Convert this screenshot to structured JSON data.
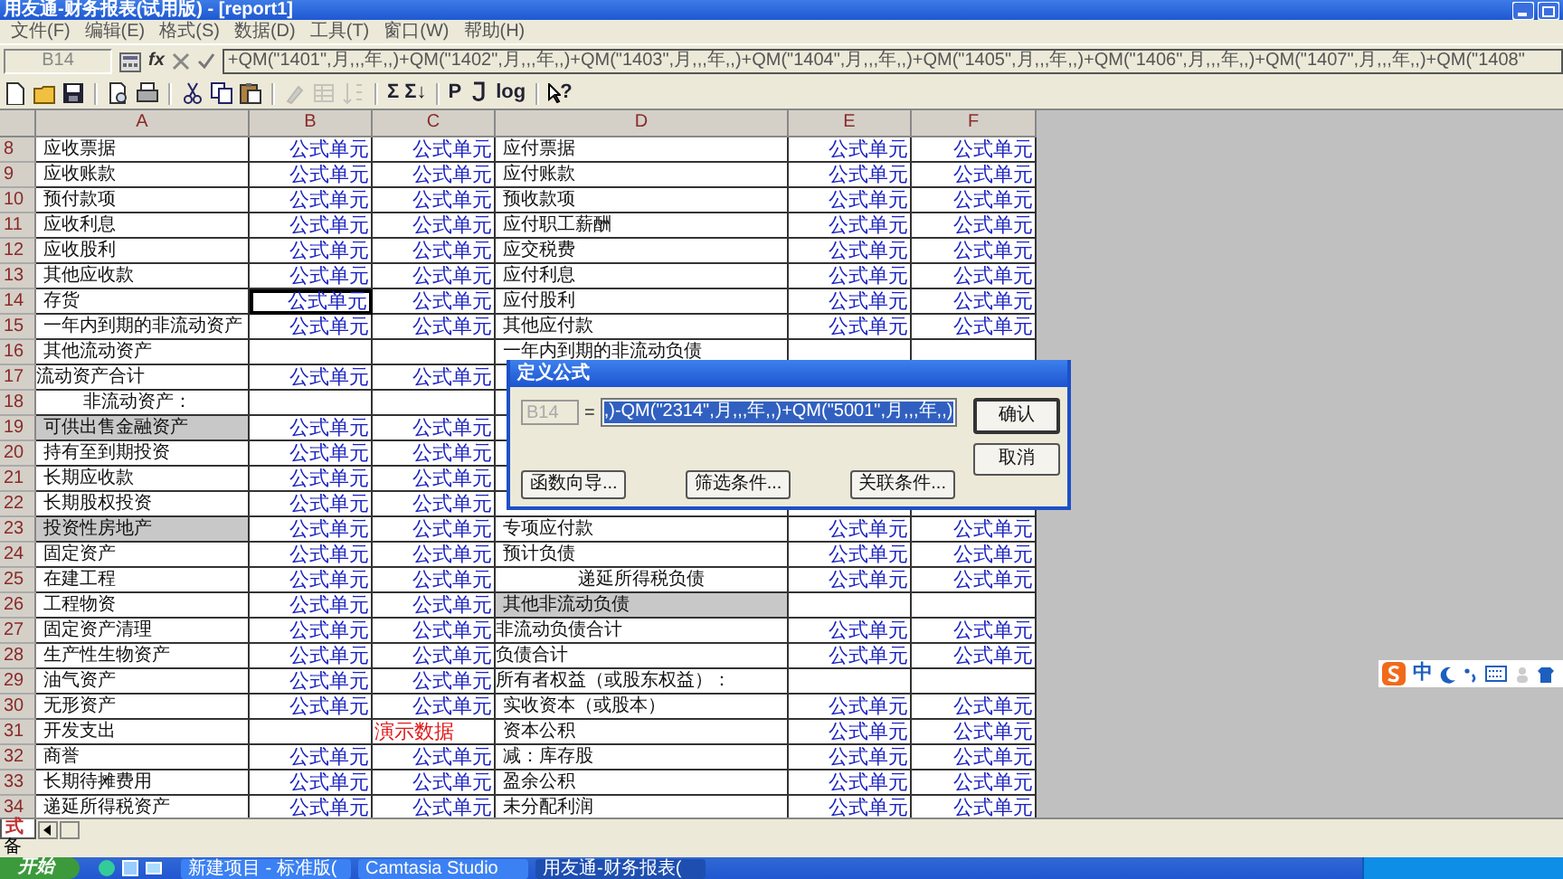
{
  "window": {
    "title": "用友通-财务报表(试用版) - [report1]"
  },
  "menu": [
    "文件(F)",
    "编辑(E)",
    "格式(S)",
    "数据(D)",
    "工具(T)",
    "窗口(W)",
    "帮助(H)"
  ],
  "formula_bar": {
    "cell": "B14",
    "fx": "fx",
    "formula": "+QM(\"1401\",月,,,年,,)+QM(\"1402\",月,,,年,,)+QM(\"1403\",月,,,年,,)+QM(\"1404\",月,,,年,,)+QM(\"1405\",月,,,年,,)+QM(\"1406\",月,,,年,,)+QM(\"1407\",月,,,年,,)+QM(\"1408\""
  },
  "toolbar": [
    {
      "kind": "new",
      "disabled": false
    },
    {
      "kind": "open",
      "disabled": false
    },
    {
      "kind": "save",
      "disabled": false
    },
    {
      "kind": "sep",
      "disabled": false
    },
    {
      "kind": "preview",
      "disabled": false
    },
    {
      "kind": "print",
      "disabled": false
    },
    {
      "kind": "sep",
      "disabled": false
    },
    {
      "kind": "cut",
      "disabled": false
    },
    {
      "kind": "copy",
      "disabled": false
    },
    {
      "kind": "paste",
      "disabled": false
    },
    {
      "kind": "sep",
      "disabled": false
    },
    {
      "kind": "brush",
      "disabled": true
    },
    {
      "kind": "table",
      "disabled": true
    },
    {
      "kind": "sort",
      "disabled": true
    },
    {
      "kind": "sep",
      "disabled": false
    },
    {
      "kind": "text",
      "label": "Σ",
      "disabled": false
    },
    {
      "kind": "text",
      "label": "Σ↓",
      "disabled": false
    },
    {
      "kind": "sep",
      "disabled": false
    },
    {
      "kind": "text",
      "label": "P",
      "disabled": false
    },
    {
      "kind": "hook",
      "disabled": false
    },
    {
      "kind": "text",
      "label": "log",
      "disabled": false
    },
    {
      "kind": "sep",
      "disabled": false
    },
    {
      "kind": "help",
      "label": "?",
      "disabled": false
    }
  ],
  "sheet": {
    "columns": [
      "A",
      "B",
      "C",
      "D",
      "E",
      "F"
    ],
    "rows": [
      {
        "number": "8",
        "cells": [
          {
            "text": "应收票据",
            "kind": "label",
            "shaded": false,
            "selected": false
          },
          {
            "text": "公式单元",
            "kind": "formula",
            "shaded": false,
            "selected": false
          },
          {
            "text": "公式单元",
            "kind": "formula",
            "shaded": false,
            "selected": false
          },
          {
            "text": "应付票据",
            "kind": "label",
            "shaded": false,
            "selected": false
          },
          {
            "text": "公式单元",
            "kind": "formula",
            "shaded": false,
            "selected": false
          },
          {
            "text": "公式单元",
            "kind": "formula",
            "shaded": false,
            "selected": false
          }
        ]
      },
      {
        "number": "9",
        "cells": [
          {
            "text": "应收账款",
            "kind": "label",
            "shaded": false,
            "selected": false
          },
          {
            "text": "公式单元",
            "kind": "formula",
            "shaded": false,
            "selected": false
          },
          {
            "text": "公式单元",
            "kind": "formula",
            "shaded": false,
            "selected": false
          },
          {
            "text": "应付账款",
            "kind": "label",
            "shaded": false,
            "selected": false
          },
          {
            "text": "公式单元",
            "kind": "formula",
            "shaded": false,
            "selected": false
          },
          {
            "text": "公式单元",
            "kind": "formula",
            "shaded": false,
            "selected": false
          }
        ]
      },
      {
        "number": "10",
        "cells": [
          {
            "text": "预付款项",
            "kind": "label",
            "shaded": false,
            "selected": false
          },
          {
            "text": "公式单元",
            "kind": "formula",
            "shaded": false,
            "selected": false
          },
          {
            "text": "公式单元",
            "kind": "formula",
            "shaded": false,
            "selected": false
          },
          {
            "text": "预收款项",
            "kind": "label",
            "shaded": false,
            "selected": false
          },
          {
            "text": "公式单元",
            "kind": "formula",
            "shaded": false,
            "selected": false
          },
          {
            "text": "公式单元",
            "kind": "formula",
            "shaded": false,
            "selected": false
          }
        ]
      },
      {
        "number": "11",
        "cells": [
          {
            "text": "应收利息",
            "kind": "label",
            "shaded": false,
            "selected": false
          },
          {
            "text": "公式单元",
            "kind": "formula",
            "shaded": false,
            "selected": false
          },
          {
            "text": "公式单元",
            "kind": "formula",
            "shaded": false,
            "selected": false
          },
          {
            "text": "应付职工薪酬",
            "kind": "label",
            "shaded": false,
            "selected": false
          },
          {
            "text": "公式单元",
            "kind": "formula",
            "shaded": false,
            "selected": false
          },
          {
            "text": "公式单元",
            "kind": "formula",
            "shaded": false,
            "selected": false
          }
        ]
      },
      {
        "number": "12",
        "cells": [
          {
            "text": "应收股利",
            "kind": "label",
            "shaded": false,
            "selected": false
          },
          {
            "text": "公式单元",
            "kind": "formula",
            "shaded": false,
            "selected": false
          },
          {
            "text": "公式单元",
            "kind": "formula",
            "shaded": false,
            "selected": false
          },
          {
            "text": "应交税费",
            "kind": "label",
            "shaded": false,
            "selected": false
          },
          {
            "text": "公式单元",
            "kind": "formula",
            "shaded": false,
            "selected": false
          },
          {
            "text": "公式单元",
            "kind": "formula",
            "shaded": false,
            "selected": false
          }
        ]
      },
      {
        "number": "13",
        "cells": [
          {
            "text": "其他应收款",
            "kind": "label",
            "shaded": false,
            "selected": false
          },
          {
            "text": "公式单元",
            "kind": "formula",
            "shaded": false,
            "selected": false
          },
          {
            "text": "公式单元",
            "kind": "formula",
            "shaded": false,
            "selected": false
          },
          {
            "text": "应付利息",
            "kind": "label",
            "shaded": false,
            "selected": false
          },
          {
            "text": "公式单元",
            "kind": "formula",
            "shaded": false,
            "selected": false
          },
          {
            "text": "公式单元",
            "kind": "formula",
            "shaded": false,
            "selected": false
          }
        ]
      },
      {
        "number": "14",
        "cells": [
          {
            "text": "存货",
            "kind": "label",
            "shaded": false,
            "selected": false
          },
          {
            "text": "公式单元",
            "kind": "formula",
            "shaded": false,
            "selected": true
          },
          {
            "text": "公式单元",
            "kind": "formula",
            "shaded": false,
            "selected": false
          },
          {
            "text": "应付股利",
            "kind": "label",
            "shaded": false,
            "selected": false
          },
          {
            "text": "公式单元",
            "kind": "formula",
            "shaded": false,
            "selected": false
          },
          {
            "text": "公式单元",
            "kind": "formula",
            "shaded": false,
            "selected": false
          }
        ]
      },
      {
        "number": "15",
        "cells": [
          {
            "text": "一年内到期的非流动资产",
            "kind": "label",
            "shaded": false,
            "selected": false
          },
          {
            "text": "公式单元",
            "kind": "formula",
            "shaded": false,
            "selected": false
          },
          {
            "text": "公式单元",
            "kind": "formula",
            "shaded": false,
            "selected": false
          },
          {
            "text": "其他应付款",
            "kind": "label",
            "shaded": false,
            "selected": false
          },
          {
            "text": "公式单元",
            "kind": "formula",
            "shaded": false,
            "selected": false
          },
          {
            "text": "公式单元",
            "kind": "formula",
            "shaded": false,
            "selected": false
          }
        ]
      },
      {
        "number": "16",
        "cells": [
          {
            "text": "其他流动资产",
            "kind": "label",
            "shaded": false,
            "selected": false
          },
          {
            "kind": "blank",
            "shaded": false,
            "selected": false
          },
          {
            "kind": "blank",
            "shaded": false,
            "selected": false
          },
          {
            "text": "一年内到期的非流动负债",
            "kind": "label",
            "shaded": false,
            "selected": false
          },
          {
            "kind": "blank",
            "shaded": false,
            "selected": false
          },
          {
            "kind": "blank",
            "shaded": false,
            "selected": false
          }
        ]
      },
      {
        "number": "17",
        "cells": [
          {
            "text": "流动资产合计",
            "kind": "heading",
            "shaded": false,
            "selected": false
          },
          {
            "text": "公式单元",
            "kind": "formula",
            "shaded": false,
            "selected": false
          },
          {
            "text": "公式单元",
            "kind": "formula",
            "shaded": false,
            "selected": false
          }
        ]
      },
      {
        "number": "18",
        "cells": [
          {
            "text": "非流动资产：",
            "kind": "subhead",
            "shaded": false,
            "selected": false
          },
          {
            "kind": "blank",
            "shaded": false,
            "selected": false
          },
          {
            "kind": "blank",
            "shaded": false,
            "selected": false
          }
        ]
      },
      {
        "number": "19",
        "cells": [
          {
            "text": "可供出售金融资产",
            "kind": "label",
            "shaded": true,
            "selected": false
          },
          {
            "text": "公式单元",
            "kind": "formula",
            "shaded": false,
            "selected": false
          },
          {
            "text": "公式单元",
            "kind": "formula",
            "shaded": false,
            "selected": false
          }
        ]
      },
      {
        "number": "20",
        "cells": [
          {
            "text": "持有至到期投资",
            "kind": "label",
            "shaded": false,
            "selected": false
          },
          {
            "text": "公式单元",
            "kind": "formula",
            "shaded": false,
            "selected": false
          },
          {
            "text": "公式单元",
            "kind": "formula",
            "shaded": false,
            "selected": false
          }
        ]
      },
      {
        "number": "21",
        "cells": [
          {
            "text": "长期应收款",
            "kind": "label",
            "shaded": false,
            "selected": false
          },
          {
            "text": "公式单元",
            "kind": "formula",
            "shaded": false,
            "selected": false
          },
          {
            "text": "公式单元",
            "kind": "formula",
            "shaded": false,
            "selected": false
          }
        ]
      },
      {
        "number": "22",
        "cells": [
          {
            "text": "长期股权投资",
            "kind": "label",
            "shaded": false,
            "selected": false
          },
          {
            "text": "公式单元",
            "kind": "formula",
            "shaded": false,
            "selected": false
          },
          {
            "text": "公式单元",
            "kind": "formula",
            "shaded": false,
            "selected": false
          }
        ]
      },
      {
        "number": "23",
        "cells": [
          {
            "text": "投资性房地产",
            "kind": "label",
            "shaded": true,
            "selected": false
          },
          {
            "text": "公式单元",
            "kind": "formula",
            "shaded": false,
            "selected": false
          },
          {
            "text": "公式单元",
            "kind": "formula",
            "shaded": false,
            "selected": false
          },
          {
            "text": "专项应付款",
            "kind": "label",
            "shaded": false,
            "selected": false
          },
          {
            "text": "公式单元",
            "kind": "formula",
            "shaded": false,
            "selected": false
          },
          {
            "text": "公式单元",
            "kind": "formula",
            "shaded": false,
            "selected": false
          }
        ]
      },
      {
        "number": "24",
        "cells": [
          {
            "text": "固定资产",
            "kind": "label",
            "shaded": false,
            "selected": false
          },
          {
            "text": "公式单元",
            "kind": "formula",
            "shaded": false,
            "selected": false
          },
          {
            "text": "公式单元",
            "kind": "formula",
            "shaded": false,
            "selected": false
          },
          {
            "text": "预计负债",
            "kind": "label",
            "shaded": false,
            "selected": false
          },
          {
            "text": "公式单元",
            "kind": "formula",
            "shaded": false,
            "selected": false
          },
          {
            "text": "公式单元",
            "kind": "formula",
            "shaded": false,
            "selected": false
          }
        ]
      },
      {
        "number": "25",
        "cells": [
          {
            "text": "在建工程",
            "kind": "label",
            "shaded": false,
            "selected": false
          },
          {
            "text": "公式单元",
            "kind": "formula",
            "shaded": false,
            "selected": false
          },
          {
            "text": "公式单元",
            "kind": "formula",
            "shaded": false,
            "selected": false
          },
          {
            "text": "递延所得税负债",
            "kind": "center",
            "shaded": false,
            "selected": false
          },
          {
            "text": "公式单元",
            "kind": "formula",
            "shaded": false,
            "selected": false
          },
          {
            "text": "公式单元",
            "kind": "formula",
            "shaded": false,
            "selected": false
          }
        ]
      },
      {
        "number": "26",
        "cells": [
          {
            "text": "工程物资",
            "kind": "label",
            "shaded": false,
            "selected": false
          },
          {
            "text": "公式单元",
            "kind": "formula",
            "shaded": false,
            "selected": false
          },
          {
            "text": "公式单元",
            "kind": "formula",
            "shaded": false,
            "selected": false
          },
          {
            "text": "其他非流动负债",
            "kind": "label",
            "shaded": true,
            "selected": false
          },
          {
            "kind": "blank",
            "shaded": false,
            "selected": false
          },
          {
            "kind": "blank",
            "shaded": false,
            "selected": false
          }
        ]
      },
      {
        "number": "27",
        "cells": [
          {
            "text": "固定资产清理",
            "kind": "label",
            "shaded": false,
            "selected": false
          },
          {
            "text": "公式单元",
            "kind": "formula",
            "shaded": false,
            "selected": false
          },
          {
            "text": "公式单元",
            "kind": "formula",
            "shaded": false,
            "selected": false
          },
          {
            "text": "非流动负债合计",
            "kind": "heading",
            "shaded": false,
            "selected": false
          },
          {
            "text": "公式单元",
            "kind": "formula",
            "shaded": false,
            "selected": false
          },
          {
            "text": "公式单元",
            "kind": "formula",
            "shaded": false,
            "selected": false
          }
        ]
      },
      {
        "number": "28",
        "cells": [
          {
            "text": "生产性生物资产",
            "kind": "label",
            "shaded": false,
            "selected": false
          },
          {
            "text": "公式单元",
            "kind": "formula",
            "shaded": false,
            "selected": false
          },
          {
            "text": "公式单元",
            "kind": "formula",
            "shaded": false,
            "selected": false
          },
          {
            "text": "负债合计",
            "kind": "heading",
            "shaded": false,
            "selected": false
          },
          {
            "text": "公式单元",
            "kind": "formula",
            "shaded": false,
            "selected": false
          },
          {
            "text": "公式单元",
            "kind": "formula",
            "shaded": false,
            "selected": false
          }
        ]
      },
      {
        "number": "29",
        "cells": [
          {
            "text": "油气资产",
            "kind": "label",
            "shaded": false,
            "selected": false
          },
          {
            "text": "公式单元",
            "kind": "formula",
            "shaded": false,
            "selected": false
          },
          {
            "text": "公式单元",
            "kind": "formula",
            "shaded": false,
            "selected": false
          },
          {
            "text": "所有者权益（或股东权益）：",
            "kind": "heading",
            "shaded": false,
            "selected": false
          },
          {
            "kind": "blank",
            "shaded": false,
            "selected": false
          },
          {
            "kind": "blank",
            "shaded": false,
            "selected": false
          }
        ]
      },
      {
        "number": "30",
        "cells": [
          {
            "text": "无形资产",
            "kind": "label",
            "shaded": false,
            "selected": false
          },
          {
            "text": "公式单元",
            "kind": "formula",
            "shaded": false,
            "selected": false
          },
          {
            "text": "公式单元",
            "kind": "formula",
            "shaded": false,
            "selected": false
          },
          {
            "text": "实收资本（或股本）",
            "kind": "label",
            "shaded": false,
            "selected": false
          },
          {
            "text": "公式单元",
            "kind": "formula",
            "shaded": false,
            "selected": false
          },
          {
            "text": "公式单元",
            "kind": "formula",
            "shaded": false,
            "selected": false
          }
        ]
      },
      {
        "number": "31",
        "cells": [
          {
            "text": "开发支出",
            "kind": "label",
            "shaded": false,
            "selected": false
          },
          {
            "kind": "blank",
            "shaded": false,
            "selected": false
          },
          {
            "text": "演示数据",
            "kind": "note",
            "shaded": false,
            "selected": false
          },
          {
            "text": "资本公积",
            "kind": "label",
            "shaded": false,
            "selected": false
          },
          {
            "text": "公式单元",
            "kind": "formula",
            "shaded": false,
            "selected": false
          },
          {
            "text": "公式单元",
            "kind": "formula",
            "shaded": false,
            "selected": false
          }
        ]
      },
      {
        "number": "32",
        "cells": [
          {
            "text": "商誉",
            "kind": "label",
            "shaded": false,
            "selected": false
          },
          {
            "text": "公式单元",
            "kind": "formula",
            "shaded": false,
            "selected": false
          },
          {
            "text": "公式单元",
            "kind": "formula",
            "shaded": false,
            "selected": false
          },
          {
            "text": "减：库存股",
            "kind": "label",
            "shaded": false,
            "selected": false
          },
          {
            "text": "公式单元",
            "kind": "formula",
            "shaded": false,
            "selected": false
          },
          {
            "text": "公式单元",
            "kind": "formula",
            "shaded": false,
            "selected": false
          }
        ]
      },
      {
        "number": "33",
        "cells": [
          {
            "text": "长期待摊费用",
            "kind": "label",
            "shaded": false,
            "selected": false
          },
          {
            "text": "公式单元",
            "kind": "formula",
            "shaded": false,
            "selected": false
          },
          {
            "text": "公式单元",
            "kind": "formula",
            "shaded": false,
            "selected": false
          },
          {
            "text": "盈余公积",
            "kind": "label",
            "shaded": false,
            "selected": false
          },
          {
            "text": "公式单元",
            "kind": "formula",
            "shaded": false,
            "selected": false
          },
          {
            "text": "公式单元",
            "kind": "formula",
            "shaded": false,
            "selected": false
          }
        ]
      },
      {
        "number": "34",
        "cells": [
          {
            "text": "递延所得税资产",
            "kind": "label",
            "shaded": false,
            "selected": false
          },
          {
            "text": "公式单元",
            "kind": "formula",
            "shaded": false,
            "selected": false
          },
          {
            "text": "公式单元",
            "kind": "formula",
            "shaded": false,
            "selected": false
          },
          {
            "text": "未分配利润",
            "kind": "label",
            "shaded": false,
            "selected": false
          },
          {
            "text": "公式单元",
            "kind": "formula",
            "shaded": false,
            "selected": false
          },
          {
            "text": "公式单元",
            "kind": "formula",
            "shaded": false,
            "selected": false
          }
        ]
      }
    ]
  },
  "sheet_tabs": [
    {
      "label": "式",
      "selected": true
    }
  ],
  "status_bar": "备",
  "dialog": {
    "title": "定义公式",
    "cell": "B14",
    "equals": "=",
    "formula": ",)-QM(\"2314\",月,,,年,,)+QM(\"5001\",月,,,年,,)",
    "side_buttons": [
      "确认",
      "取消"
    ],
    "bottom_buttons": [
      "函数向导...",
      "筛选条件...",
      "关联条件..."
    ]
  },
  "ime_bar": {
    "mode": "中"
  },
  "taskbar": {
    "start": "开始",
    "tasks": [
      {
        "label": "新建项目 - 标准版(",
        "selected": false
      },
      {
        "label": "Camtasia Studio",
        "selected": false
      },
      {
        "label": "用友通-财务报表(",
        "selected": true
      }
    ]
  }
}
